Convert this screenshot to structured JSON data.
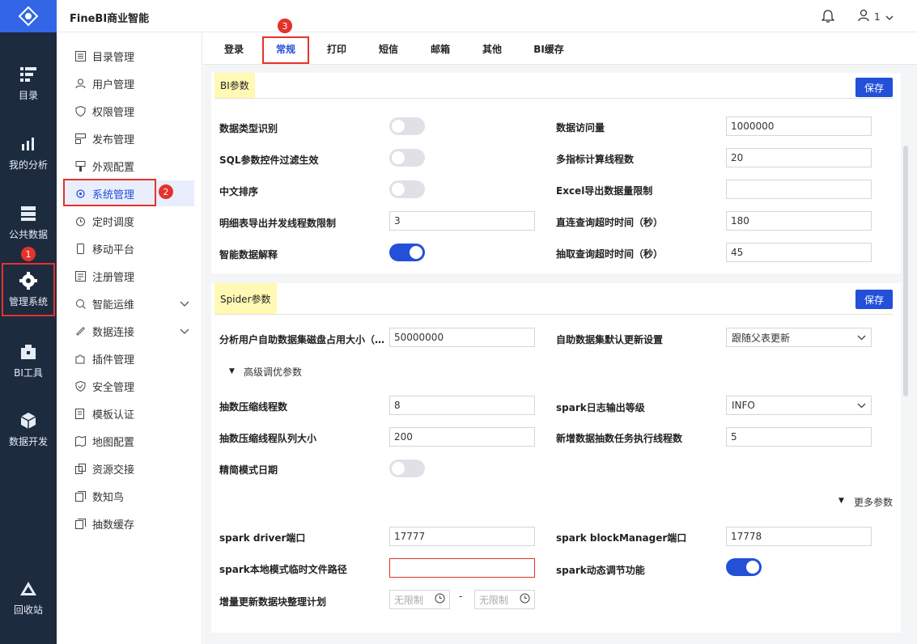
{
  "app": {
    "title": "FineBI商业智能",
    "user": "1"
  },
  "rail": {
    "items": [
      {
        "label": "目录",
        "icon": "catalog-icon"
      },
      {
        "label": "我的分析",
        "icon": "analysis-icon"
      },
      {
        "label": "公共数据",
        "icon": "public-data-icon"
      },
      {
        "label": "管理系统",
        "icon": "gear-icon"
      },
      {
        "label": "BI工具",
        "icon": "toolbox-icon"
      },
      {
        "label": "数据开发",
        "icon": "cube-icon"
      },
      {
        "label": "回收站",
        "icon": "recycle-icon"
      }
    ],
    "badge": "1"
  },
  "sidebar": {
    "items": [
      {
        "label": "目录管理"
      },
      {
        "label": "用户管理"
      },
      {
        "label": "权限管理"
      },
      {
        "label": "发布管理"
      },
      {
        "label": "外观配置"
      },
      {
        "label": "系统管理"
      },
      {
        "label": "定时调度"
      },
      {
        "label": "移动平台"
      },
      {
        "label": "注册管理"
      },
      {
        "label": "智能运维"
      },
      {
        "label": "数据连接"
      },
      {
        "label": "插件管理"
      },
      {
        "label": "安全管理"
      },
      {
        "label": "模板认证"
      },
      {
        "label": "地图配置"
      },
      {
        "label": "资源交接"
      },
      {
        "label": "数知鸟"
      },
      {
        "label": "抽数缓存"
      }
    ],
    "badge": "2"
  },
  "tabs": {
    "items": [
      "登录",
      "常规",
      "打印",
      "短信",
      "邮箱",
      "其他",
      "BI缓存"
    ],
    "active": "常规",
    "badge": "3"
  },
  "bi_params": {
    "title": "BI参数",
    "save": "保存",
    "left": [
      {
        "label": "数据类型识别",
        "toggle": false
      },
      {
        "label": "SQL参数控件过滤生效",
        "toggle": false
      },
      {
        "label": "中文排序",
        "toggle": false
      },
      {
        "label": "明细表导出并发线程数限制",
        "value": "3"
      },
      {
        "label": "智能数据解释",
        "toggle": true
      }
    ],
    "right": [
      {
        "label": "数据访问量",
        "value": "1000000"
      },
      {
        "label": "多指标计算线程数",
        "value": "20"
      },
      {
        "label": "Excel导出数据量限制",
        "value": ""
      },
      {
        "label": "直连查询超时时间（秒）",
        "value": "180"
      },
      {
        "label": "抽取查询超时时间（秒）",
        "value": "45"
      }
    ]
  },
  "spider_params": {
    "title": "Spider参数",
    "save": "保存",
    "disk_label": "分析用户自助数据集磁盘占用大小（…",
    "disk_value": "50000000",
    "update_label": "自助数据集默认更新设置",
    "update_value": "跟随父表更新",
    "advanced": "高级调优参数",
    "compress_threads_label": "抽数压缩线程数",
    "compress_threads_value": "8",
    "log_level_label": "spark日志输出等级",
    "log_level_value": "INFO",
    "queue_label": "抽数压缩线程队列大小",
    "queue_value": "200",
    "task_threads_label": "新增数据抽数任务执行线程数",
    "task_threads_value": "5",
    "simple_date_label": "精简模式日期",
    "simple_date_toggle": false,
    "more": "更多参数",
    "driver_port_label": "spark driver端口",
    "driver_port_value": "17777",
    "bm_port_label": "spark blockManager端口",
    "bm_port_value": "17778",
    "tmp_path_label": "spark本地模式临时文件路径",
    "tmp_path_value": "",
    "dyn_label": "spark动态调节功能",
    "dyn_toggle": true,
    "plan_label": "增量更新数据块整理计划",
    "plan_from": "无限制",
    "plan_sep": "-",
    "plan_to": "无限制"
  }
}
